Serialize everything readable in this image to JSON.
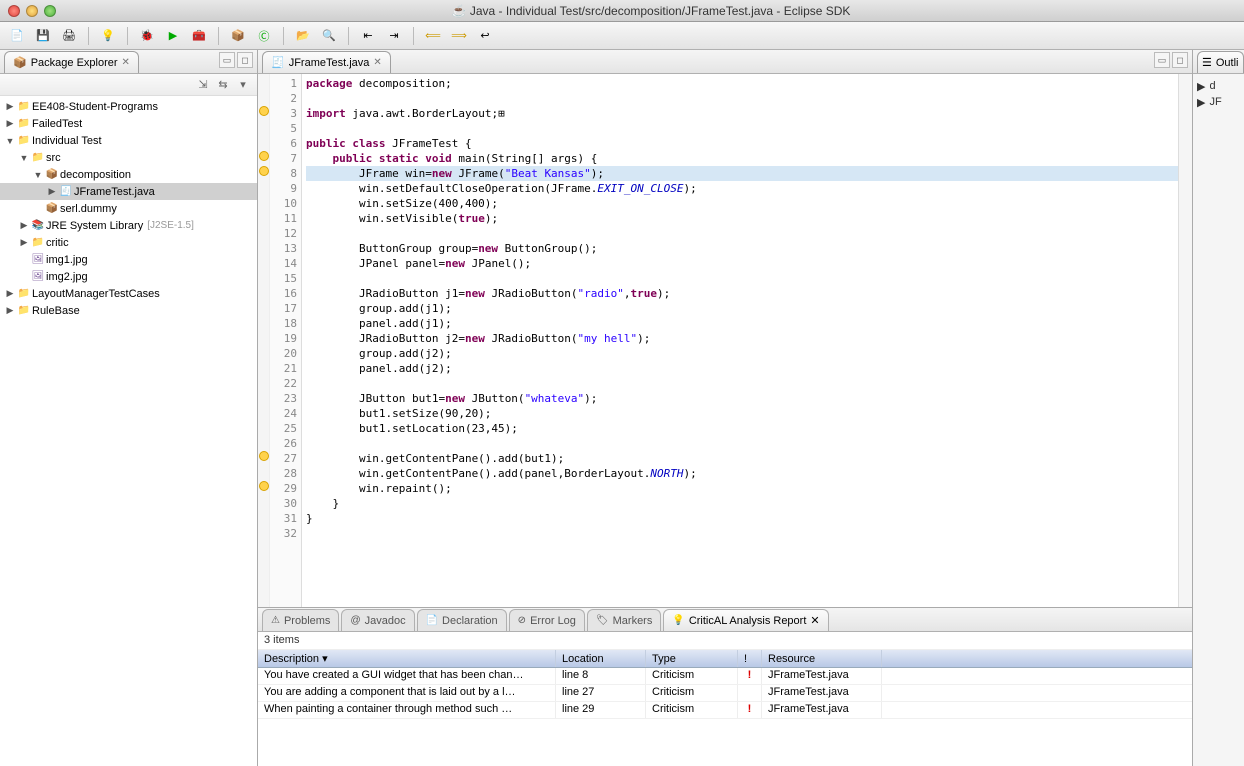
{
  "window": {
    "title": "Java - Individual Test/src/decomposition/JFrameTest.java - Eclipse SDK",
    "app_icon": "☕"
  },
  "package_explorer": {
    "title": "Package Explorer",
    "items": [
      {
        "l": "EE408-Student-Programs",
        "ind": 0,
        "tw": "▶",
        "ic": "📁",
        "cls": "ico-proj"
      },
      {
        "l": "FailedTest",
        "ind": 0,
        "tw": "▶",
        "ic": "📁",
        "cls": "ico-proj"
      },
      {
        "l": "Individual Test",
        "ind": 0,
        "tw": "▼",
        "ic": "📁",
        "cls": "ico-proj"
      },
      {
        "l": "src",
        "ind": 1,
        "tw": "▼",
        "ic": "📁",
        "cls": "ico-folder"
      },
      {
        "l": "decomposition",
        "ind": 2,
        "tw": "▼",
        "ic": "📦",
        "cls": "ico-pkg"
      },
      {
        "l": "JFrameTest.java",
        "ind": 3,
        "tw": "▶",
        "ic": "🧾",
        "cls": "ico-java",
        "sel": true
      },
      {
        "l": "serl.dummy",
        "ind": 2,
        "tw": "",
        "ic": "📦",
        "cls": "ico-pkg"
      },
      {
        "l": "JRE System Library",
        "ind": 1,
        "tw": "▶",
        "ic": "📚",
        "cls": "ico-lib",
        "extra": "[J2SE-1.5]"
      },
      {
        "l": "critic",
        "ind": 1,
        "tw": "▶",
        "ic": "📁",
        "cls": "ico-folder"
      },
      {
        "l": "img1.jpg",
        "ind": 1,
        "tw": "",
        "ic": "🖼",
        "cls": "ico-img"
      },
      {
        "l": "img2.jpg",
        "ind": 1,
        "tw": "",
        "ic": "🖼",
        "cls": "ico-img"
      },
      {
        "l": "LayoutManagerTestCases",
        "ind": 0,
        "tw": "▶",
        "ic": "📁",
        "cls": "ico-proj"
      },
      {
        "l": "RuleBase",
        "ind": 0,
        "tw": "▶",
        "ic": "📁",
        "cls": "ico-proj"
      }
    ]
  },
  "editor": {
    "tab": "JFrameTest.java",
    "highlight_line": 8,
    "markers": [
      {
        "line": 3,
        "t": "+"
      },
      {
        "line": 7,
        "t": "−"
      },
      {
        "line": 8,
        "t": "!"
      },
      {
        "line": 27,
        "t": "!"
      },
      {
        "line": 29,
        "t": "!"
      }
    ],
    "lines": [
      {
        "n": 1,
        "segs": [
          {
            "c": "kw",
            "t": "package"
          },
          {
            "t": " decomposition;"
          }
        ]
      },
      {
        "n": 2,
        "segs": [
          {
            "t": ""
          }
        ]
      },
      {
        "n": 3,
        "segs": [
          {
            "c": "kw",
            "t": "import"
          },
          {
            "t": " java.awt.BorderLayout;"
          },
          {
            "t": "⊞"
          }
        ]
      },
      {
        "n": 5,
        "segs": [
          {
            "t": ""
          }
        ]
      },
      {
        "n": 6,
        "segs": [
          {
            "c": "kw",
            "t": "public class"
          },
          {
            "t": " JFrameTest {"
          }
        ]
      },
      {
        "n": 7,
        "segs": [
          {
            "t": "    "
          },
          {
            "c": "kw",
            "t": "public static void"
          },
          {
            "t": " main(String[] args) {"
          }
        ]
      },
      {
        "n": 8,
        "segs": [
          {
            "t": "        JFrame win="
          },
          {
            "c": "kw",
            "t": "new"
          },
          {
            "t": " JFrame("
          },
          {
            "c": "str",
            "t": "\"Beat Kansas\""
          },
          {
            "t": ");"
          }
        ]
      },
      {
        "n": 9,
        "segs": [
          {
            "t": "        win.setDefaultCloseOperation(JFrame."
          },
          {
            "c": "con",
            "t": "EXIT_ON_CLOSE"
          },
          {
            "t": ");"
          }
        ]
      },
      {
        "n": 10,
        "segs": [
          {
            "t": "        win.setSize(400,400);"
          }
        ]
      },
      {
        "n": 11,
        "segs": [
          {
            "t": "        win.setVisible("
          },
          {
            "c": "kw",
            "t": "true"
          },
          {
            "t": ");"
          }
        ]
      },
      {
        "n": 12,
        "segs": [
          {
            "t": ""
          }
        ]
      },
      {
        "n": 13,
        "segs": [
          {
            "t": "        ButtonGroup group="
          },
          {
            "c": "kw",
            "t": "new"
          },
          {
            "t": " ButtonGroup();"
          }
        ]
      },
      {
        "n": 14,
        "segs": [
          {
            "t": "        JPanel panel="
          },
          {
            "c": "kw",
            "t": "new"
          },
          {
            "t": " JPanel();"
          }
        ]
      },
      {
        "n": 15,
        "segs": [
          {
            "t": ""
          }
        ]
      },
      {
        "n": 16,
        "segs": [
          {
            "t": "        JRadioButton j1="
          },
          {
            "c": "kw",
            "t": "new"
          },
          {
            "t": " JRadioButton("
          },
          {
            "c": "str",
            "t": "\"radio\""
          },
          {
            "t": ","
          },
          {
            "c": "kw",
            "t": "true"
          },
          {
            "t": ");"
          }
        ]
      },
      {
        "n": 17,
        "segs": [
          {
            "t": "        group.add(j1);"
          }
        ]
      },
      {
        "n": 18,
        "segs": [
          {
            "t": "        panel.add(j1);"
          }
        ]
      },
      {
        "n": 19,
        "segs": [
          {
            "t": "        JRadioButton j2="
          },
          {
            "c": "kw",
            "t": "new"
          },
          {
            "t": " JRadioButton("
          },
          {
            "c": "str",
            "t": "\"my hell\""
          },
          {
            "t": ");"
          }
        ]
      },
      {
        "n": 20,
        "segs": [
          {
            "t": "        group.add(j2);"
          }
        ]
      },
      {
        "n": 21,
        "segs": [
          {
            "t": "        panel.add(j2);"
          }
        ]
      },
      {
        "n": 22,
        "segs": [
          {
            "t": ""
          }
        ]
      },
      {
        "n": 23,
        "segs": [
          {
            "t": "        JButton but1="
          },
          {
            "c": "kw",
            "t": "new"
          },
          {
            "t": " JButton("
          },
          {
            "c": "str",
            "t": "\"whateva\""
          },
          {
            "t": ");"
          }
        ]
      },
      {
        "n": 24,
        "segs": [
          {
            "t": "        but1.setSize(90,20);"
          }
        ]
      },
      {
        "n": 25,
        "segs": [
          {
            "t": "        but1.setLocation(23,45);"
          }
        ]
      },
      {
        "n": 26,
        "segs": [
          {
            "t": ""
          }
        ]
      },
      {
        "n": 27,
        "segs": [
          {
            "t": "        win.getContentPane().add(but1);"
          }
        ]
      },
      {
        "n": 28,
        "segs": [
          {
            "t": "        win.getContentPane().add(panel,BorderLayout."
          },
          {
            "c": "con",
            "t": "NORTH"
          },
          {
            "t": ");"
          }
        ]
      },
      {
        "n": 29,
        "segs": [
          {
            "t": "        win.repaint();"
          }
        ]
      },
      {
        "n": 30,
        "segs": [
          {
            "t": "    }"
          }
        ]
      },
      {
        "n": 31,
        "segs": [
          {
            "t": "}"
          }
        ]
      },
      {
        "n": 32,
        "segs": [
          {
            "t": ""
          }
        ]
      }
    ]
  },
  "outline": {
    "title": "Outli",
    "items": [
      "d",
      "JF"
    ]
  },
  "bottom": {
    "tabs": [
      {
        "l": "Problems",
        "ic": "⚠"
      },
      {
        "l": "Javadoc",
        "ic": "@"
      },
      {
        "l": "Declaration",
        "ic": "📄"
      },
      {
        "l": "Error Log",
        "ic": "⊘"
      },
      {
        "l": "Markers",
        "ic": "🏷"
      },
      {
        "l": "CriticAL Analysis Report",
        "ic": "💡",
        "active": true
      }
    ],
    "status": "3 items",
    "columns": [
      "Description",
      "Location",
      "Type",
      "!",
      "Resource"
    ],
    "rows": [
      {
        "desc": "You have created a GUI widget that has been chan…",
        "loc": "line 8",
        "type": "Criticism",
        "bang": "!",
        "res": "JFrameTest.java"
      },
      {
        "desc": "You are adding a component that is laid out by a l…",
        "loc": "line 27",
        "type": "Criticism",
        "bang": "",
        "res": "JFrameTest.java"
      },
      {
        "desc": "When painting a container through method such …",
        "loc": "line 29",
        "type": "Criticism",
        "bang": "!",
        "res": "JFrameTest.java"
      }
    ]
  }
}
